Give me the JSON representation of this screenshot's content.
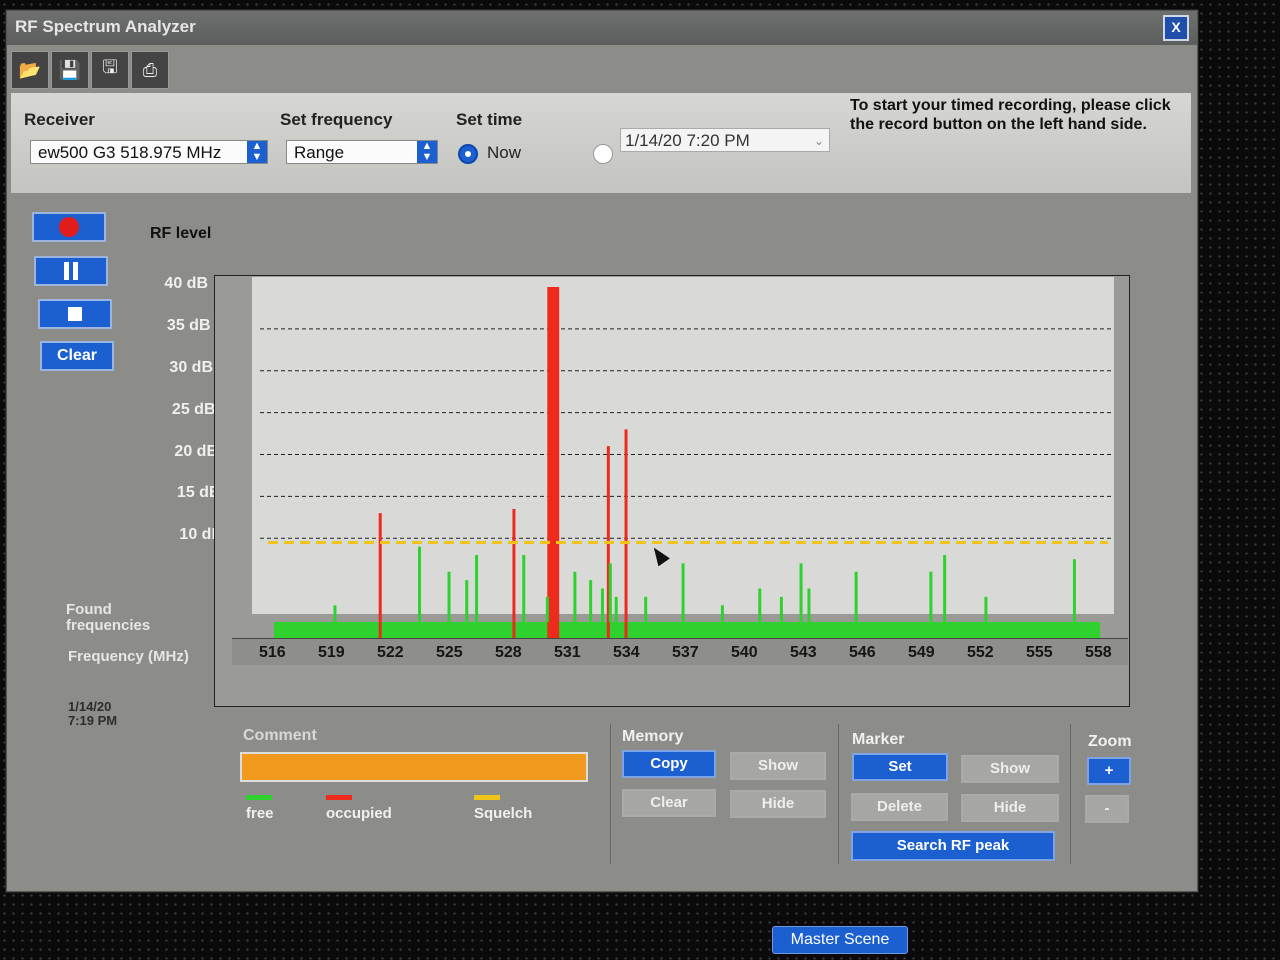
{
  "window": {
    "title": "RF Spectrum Analyzer",
    "close_label": "X"
  },
  "toolbar": {
    "icons": [
      "open-icon",
      "save-icon",
      "save-as-icon",
      "print-icon"
    ]
  },
  "receiver": {
    "label": "Receiver",
    "value": "ew500 G3 518.975 MHz"
  },
  "set_frequency": {
    "label": "Set frequency",
    "value": "Range"
  },
  "set_time": {
    "label": "Set time",
    "now_label": "Now",
    "now_selected": true,
    "datetime_value": "1/14/20 7:20 PM"
  },
  "note": "To start your timed recording, please click the record button on the left hand side.",
  "controls": {
    "clear_label": "Clear"
  },
  "rf_level_label": "RF level",
  "found_frequencies_label": "Found frequencies",
  "frequency_label": "Frequency (MHz)",
  "timestamp": {
    "date": "1/14/20",
    "time": "7:19 PM"
  },
  "colors": {
    "free": "#2fd12f",
    "occupied": "#ee2a1d",
    "squelch": "#f0c419",
    "accent": "#1b5fd0"
  },
  "chart_data": {
    "type": "bar",
    "ylabel": "RF level",
    "xlabel": "Frequency (MHz)",
    "ylim": [
      0,
      40
    ],
    "xlim": [
      516,
      558
    ],
    "y_ticks": [
      "40 dB",
      "35 dB",
      "30 dB",
      "25 dB",
      "20 dB",
      "15 dB",
      "10 dB"
    ],
    "y_tick_values": [
      40,
      35,
      30,
      25,
      20,
      15,
      10
    ],
    "x_ticks": [
      "516",
      "519",
      "522",
      "525",
      "528",
      "531",
      "534",
      "537",
      "540",
      "543",
      "546",
      "549",
      "552",
      "555",
      "558"
    ],
    "squelch_level": 9.5,
    "series": [
      {
        "name": "occupied",
        "x": [
          521.4,
          528.2,
          530.1,
          530.3,
          533.0,
          533.9
        ],
        "values": [
          13,
          13.5,
          40,
          40,
          21,
          23
        ]
      },
      {
        "name": "free",
        "x": [
          519.1,
          523.4,
          524.9,
          525.8,
          526.3,
          528.7,
          529.9,
          531.3,
          532.1,
          532.7,
          533.1,
          533.4,
          534.9,
          536.8,
          538.8,
          540.7,
          541.8,
          542.8,
          543.2,
          545.6,
          549.4,
          550.1,
          552.2,
          556.7
        ],
        "values": [
          2,
          9,
          6,
          5,
          8,
          8,
          3,
          6,
          5,
          4,
          7,
          3,
          3,
          7,
          2,
          4,
          3,
          7,
          4,
          6,
          6,
          8,
          3,
          7.5
        ]
      }
    ]
  },
  "comment": {
    "label": "Comment",
    "value": ""
  },
  "legend": {
    "free": "free",
    "occupied": "occupied",
    "squelch": "Squelch"
  },
  "memory": {
    "label": "Memory",
    "copy": "Copy",
    "show": "Show",
    "clear": "Clear",
    "hide": "Hide"
  },
  "marker": {
    "label": "Marker",
    "set": "Set",
    "show": "Show",
    "delete": "Delete",
    "hide": "Hide",
    "search": "Search RF peak"
  },
  "zoom": {
    "label": "Zoom",
    "plus": "+",
    "minus": "-"
  },
  "taskbar": {
    "master_scene": "Master Scene"
  }
}
